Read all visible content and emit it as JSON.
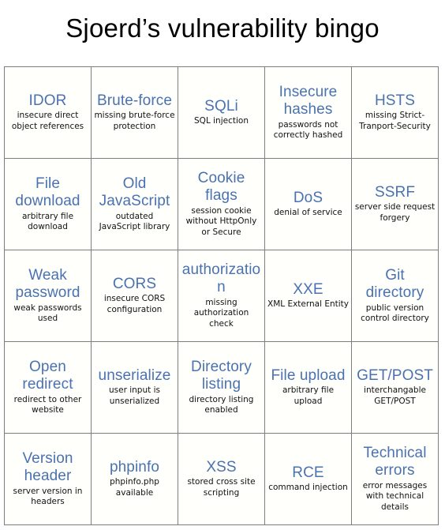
{
  "card": {
    "title": "Sjoerd’s vulnerability bingo",
    "accent_color": "#4a72b0",
    "text_color": "#111111",
    "grid_line_color": "#7d7d7d",
    "background_color": "#fffffc",
    "columns": 5,
    "rows": 5,
    "cells": [
      {
        "term": "IDOR",
        "description": "insecure direct object references"
      },
      {
        "term": "Brute-force",
        "description": "missing brute-force protection"
      },
      {
        "term": "SQLi",
        "description": "SQL injection"
      },
      {
        "term": "Insecure hashes",
        "description": "passwords not correctly hashed"
      },
      {
        "term": "HSTS",
        "description": "missing Strict-Tranport-Security"
      },
      {
        "term": "File download",
        "description": "arbitrary file download"
      },
      {
        "term": "Old JavaScript",
        "description": "outdated JavaScript library"
      },
      {
        "term": "Cookie flags",
        "description": "session cookie without HttpOnly or Secure"
      },
      {
        "term": "DoS",
        "description": "denial of service"
      },
      {
        "term": "SSRF",
        "description": "server side request forgery"
      },
      {
        "term": "Weak password",
        "description": "weak passwords used"
      },
      {
        "term": "CORS",
        "description": "insecure CORS configuration"
      },
      {
        "term": "authorization",
        "description": "missing authorization check"
      },
      {
        "term": "XXE",
        "description": "XML External Entity"
      },
      {
        "term": "Git directory",
        "description": "public version control directory"
      },
      {
        "term": "Open redirect",
        "description": "redirect to other website"
      },
      {
        "term": "unserialize",
        "description": "user input is unserialized"
      },
      {
        "term": "Directory listing",
        "description": "directory listing enabled"
      },
      {
        "term": "File upload",
        "description": "arbitrary file upload"
      },
      {
        "term": "GET/POST",
        "description": "interchangable GET/POST"
      },
      {
        "term": "Version header",
        "description": "server version in headers"
      },
      {
        "term": "phpinfo",
        "description": "phpinfo.php available"
      },
      {
        "term": "XSS",
        "description": "stored cross site scripting"
      },
      {
        "term": "RCE",
        "description": "command injection"
      },
      {
        "term": "Technical errors",
        "description": "error messages with technical details"
      }
    ]
  }
}
